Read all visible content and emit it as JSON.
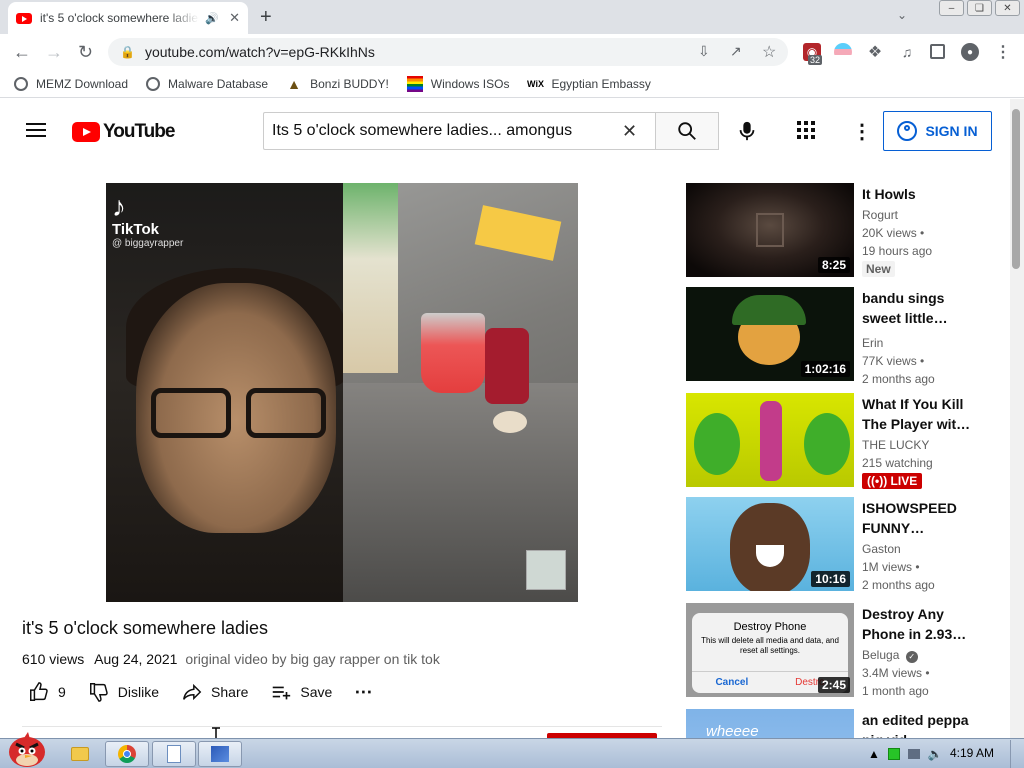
{
  "browser": {
    "tab_title": "it's 5 o'clock somewhere ladies",
    "url": "youtube.com/watch?v=epG-RKkIhNs",
    "extension_badge": "32",
    "bookmarks": [
      {
        "label": "MEMZ Download"
      },
      {
        "label": "Malware Database"
      },
      {
        "label": "Bonzi BUDDY!"
      },
      {
        "label": "Windows ISOs"
      },
      {
        "label": "Egyptian Embassy"
      }
    ]
  },
  "youtube": {
    "logo_text": "YouTube",
    "search_value": "Its 5 o'clock somewhere ladies... amongus",
    "signin_label": "SIGN IN"
  },
  "player": {
    "tiktok_label": "TikTok",
    "tiktok_handle": "@ biggayrapper"
  },
  "video": {
    "title": "it's 5 o'clock somewhere ladies",
    "views": "610 views",
    "date": "Aug 24, 2021",
    "description": "original video by big gay rapper on tik tok",
    "likes": "9",
    "dislike_label": "Dislike",
    "share_label": "Share",
    "save_label": "Save"
  },
  "recommendations": [
    {
      "title": "It Howls",
      "channel": "Rogurt",
      "views": "20K views",
      "age": "19 hours ago",
      "duration": "8:25",
      "badge": "New"
    },
    {
      "title": "bandu sings sweet little…",
      "channel": "Erin",
      "views": "77K views",
      "age": "2 months ago",
      "duration": "1:02:16"
    },
    {
      "title": "What If You Kill The Player wit…",
      "channel": "THE LUCKY",
      "views": "215 watching",
      "badge": "LIVE"
    },
    {
      "title": "ISHOWSPEED FUNNY…",
      "channel": "Gaston",
      "views": "1M views",
      "age": "2 months ago",
      "duration": "10:16"
    },
    {
      "title": "Destroy Any Phone in 2.93…",
      "channel": "Beluga",
      "views": "3.4M views",
      "age": "1 month ago",
      "duration": "2:45",
      "thumb_title": "Destroy Phone",
      "thumb_text": "This will delete all media and data, and reset all settings.",
      "thumb_cancel": "Cancel",
      "thumb_destroy": "Destro"
    },
    {
      "title": "an edited peppa pig vid…",
      "thumb_text": "wheeee"
    }
  ],
  "taskbar": {
    "time": "4:19 AM"
  }
}
